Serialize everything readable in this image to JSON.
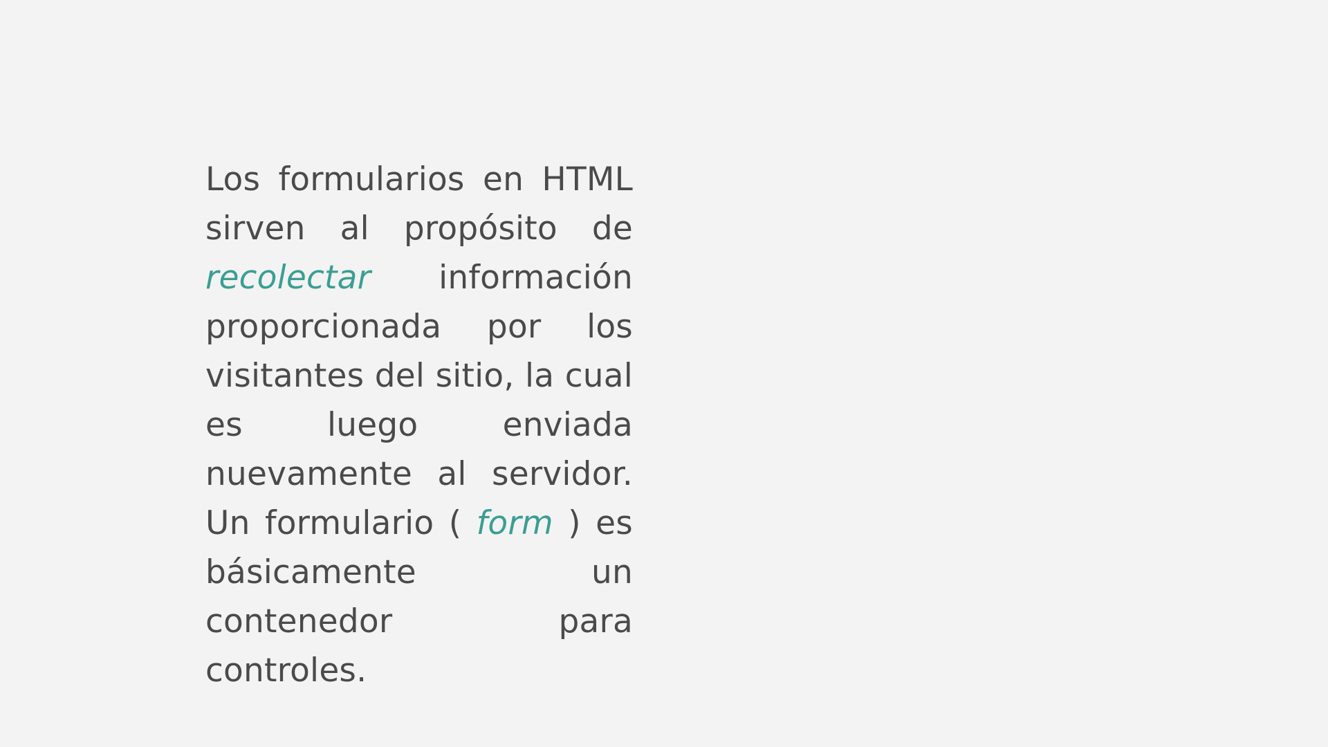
{
  "slide": {
    "paragraph": {
      "part1": "Los formularios en  HTML sirven al propósito de ",
      "emphasis1": "recolectar",
      "part2": " información proporcionada por los visitantes del sitio, la cual es luego enviada nuevamente al servidor.  Un formulario ( ",
      "emphasis2": "form",
      "part3": " ) es básicamente un contenedor para controles."
    },
    "colors": {
      "background": "#f3f3f3",
      "text": "#4a4a4a",
      "accent": "#3a9e93"
    }
  }
}
